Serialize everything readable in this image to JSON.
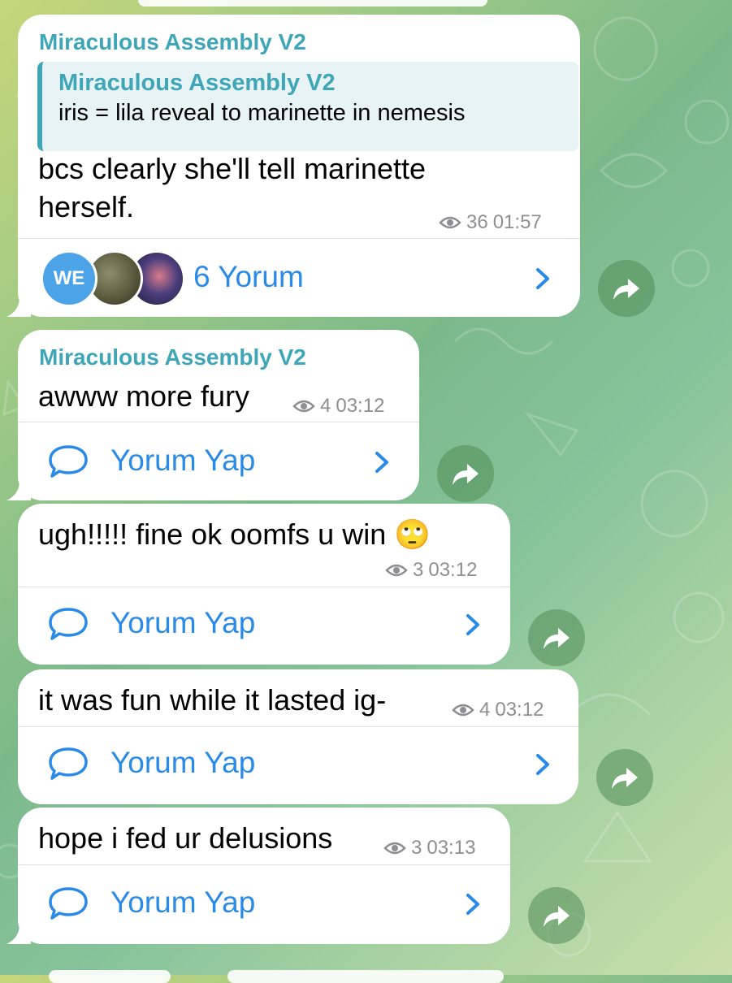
{
  "posts": [
    {
      "sender": "Miraculous Assembly V2",
      "reply": {
        "sender": "Miraculous Assembly V2",
        "text": "iris = lila reveal to marinette in nemesis"
      },
      "text_line1": "bcs clearly she'll tell marinette",
      "text_line2": "herself.",
      "views": "36",
      "time": "01:57",
      "comments_label": "6 Yorum",
      "avatar_text": "WE"
    },
    {
      "sender": "Miraculous Assembly V2",
      "text": "awww more fury",
      "views": "4",
      "time": "03:12",
      "comments_label": "Yorum Yap"
    },
    {
      "text": "ugh!!!!! fine ok oomfs u win 🙄",
      "views": "3",
      "time": "03:12",
      "comments_label": "Yorum Yap"
    },
    {
      "text": "it was fun while it lasted ig-",
      "views": "4",
      "time": "03:12",
      "comments_label": "Yorum Yap"
    },
    {
      "text": "hope i fed ur delusions",
      "views": "3",
      "time": "03:13",
      "comments_label": "Yorum Yap"
    }
  ],
  "icons": {
    "views": "eye-icon",
    "comment": "speech-bubble-icon",
    "share": "share-arrow-icon",
    "chevron": "chevron-right-icon"
  },
  "colors": {
    "sender": "#3ea6b7",
    "link": "#2a8ae8",
    "meta": "#8e8e93"
  }
}
